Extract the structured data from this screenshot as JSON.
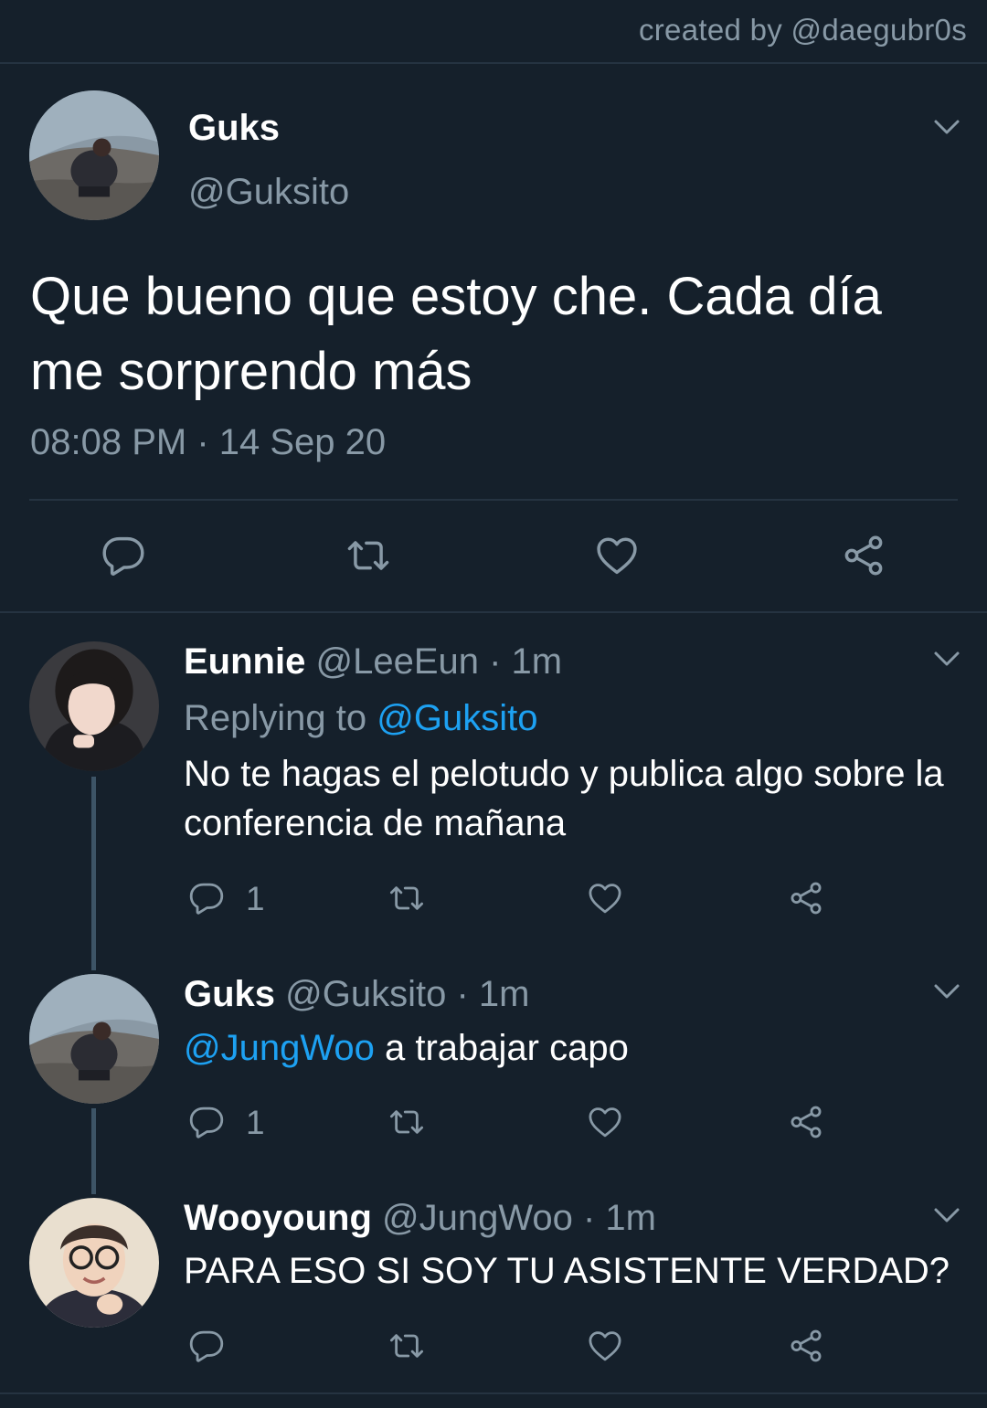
{
  "credit": "created by @daegubr0s",
  "colors": {
    "background": "#15202b",
    "secondary_text": "#8899a6",
    "link": "#1da1f2",
    "divider": "#253341"
  },
  "main_tweet": {
    "name": "Guks",
    "handle": "@Guksito",
    "text": "Que bueno que estoy che. Cada día me sorprendo más",
    "timestamp": "08:08 PM · 14 Sep 20",
    "actions": [
      "reply-icon",
      "retweet-icon",
      "like-icon",
      "share-icon"
    ]
  },
  "replies": [
    {
      "name": "Eunnie",
      "handle_time": "@LeeEun · 1m",
      "replying_prefix": "Replying to",
      "replying_mention": "@Guksito",
      "text": "No te hagas el pelotudo y publica algo sobre la conferencia de mañana",
      "reply_count": "1"
    },
    {
      "name": "Guks",
      "handle_time": "@Guksito · 1m",
      "mention": "@JungWoo",
      "text": " a trabajar capo",
      "reply_count": "1"
    },
    {
      "name": "Wooyoung",
      "handle_time": "@JungWoo · 1m",
      "text": "PARA ESO SI SOY TU ASISTENTE VERDAD?",
      "reply_count": ""
    }
  ]
}
